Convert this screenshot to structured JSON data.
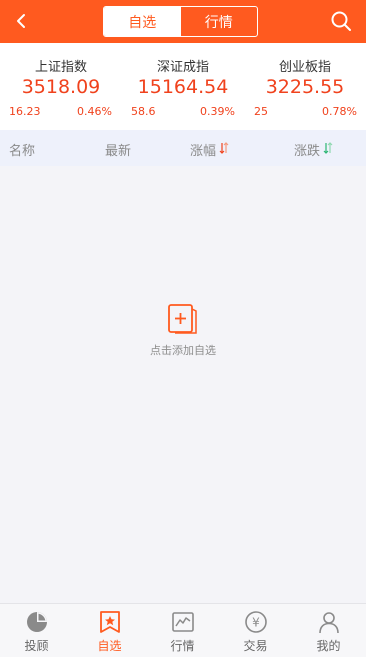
{
  "header": {
    "tabs": [
      {
        "label": "自选",
        "active": true
      },
      {
        "label": "行情",
        "active": false
      }
    ]
  },
  "indices": [
    {
      "name": "上证指数",
      "value": "3518.09",
      "change": "16.23",
      "percent": "0.46%"
    },
    {
      "name": "深证成指",
      "value": "15164.54",
      "change": "58.6",
      "percent": "0.39%"
    },
    {
      "name": "创业板指",
      "value": "3225.55",
      "change": "25",
      "percent": "0.78%"
    }
  ],
  "columns": {
    "name": "名称",
    "latest": "最新",
    "change_pct": "涨幅",
    "change": "涨跌"
  },
  "empty": {
    "text": "点击添加自选"
  },
  "tabbar": [
    {
      "label": "投顾",
      "icon": "pie-chart-icon"
    },
    {
      "label": "自选",
      "icon": "star-bookmark-icon",
      "active": true
    },
    {
      "label": "行情",
      "icon": "line-chart-icon"
    },
    {
      "label": "交易",
      "icon": "yuan-icon"
    },
    {
      "label": "我的",
      "icon": "user-icon"
    }
  ],
  "colors": {
    "accent": "#ff5a1f",
    "up": "#f0421d",
    "down": "#2bb673"
  }
}
